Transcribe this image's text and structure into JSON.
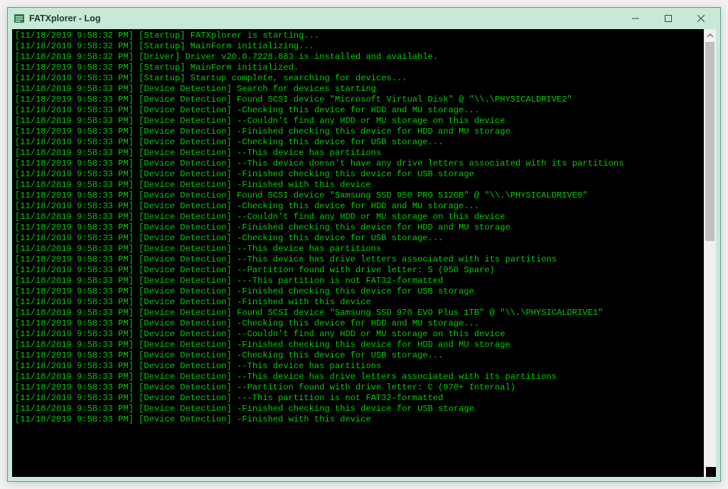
{
  "window": {
    "title": "FATXplorer - Log"
  },
  "log": {
    "lines": [
      {
        "ts": "[11/18/2019 9:58:32 PM]",
        "tag": "[Startup]",
        "msg": "FATXplorer is starting..."
      },
      {
        "ts": "[11/18/2019 9:58:32 PM]",
        "tag": "[Startup]",
        "msg": "MainForm initializing..."
      },
      {
        "ts": "[11/18/2019 9:58:32 PM]",
        "tag": "[Driver]",
        "msg": "Driver v20.0.7228.883 is installed and available."
      },
      {
        "ts": "[11/18/2019 9:58:32 PM]",
        "tag": "[Startup]",
        "msg": "MainForm initialized."
      },
      {
        "ts": "[11/18/2019 9:58:33 PM]",
        "tag": "[Startup]",
        "msg": "Startup complete, searching for devices..."
      },
      {
        "ts": "[11/18/2019 9:58:33 PM]",
        "tag": "[Device Detection]",
        "msg": "Search for devices starting"
      },
      {
        "ts": "[11/18/2019 9:58:33 PM]",
        "tag": "[Device Detection]",
        "msg": "Found SCSI device \"Microsoft Virtual Disk\" @ \"\\\\.\\PHYSICALDRIVE2\""
      },
      {
        "ts": "[11/18/2019 9:58:33 PM]",
        "tag": "[Device Detection]",
        "msg": "-Checking this device for HDD and MU storage..."
      },
      {
        "ts": "[11/18/2019 9:58:33 PM]",
        "tag": "[Device Detection]",
        "msg": "--Couldn't find any HDD or MU storage on this device"
      },
      {
        "ts": "[11/18/2019 9:58:33 PM]",
        "tag": "[Device Detection]",
        "msg": "-Finished checking this device for HDD and MU storage"
      },
      {
        "ts": "[11/18/2019 9:58:33 PM]",
        "tag": "[Device Detection]",
        "msg": "-Checking this device for USB storage..."
      },
      {
        "ts": "[11/18/2019 9:58:33 PM]",
        "tag": "[Device Detection]",
        "msg": "--This device has partitions"
      },
      {
        "ts": "[11/18/2019 9:58:33 PM]",
        "tag": "[Device Detection]",
        "msg": "--This device doesn't have any drive letters associated with its partitions"
      },
      {
        "ts": "[11/18/2019 9:58:33 PM]",
        "tag": "[Device Detection]",
        "msg": "-Finished checking this device for USB storage"
      },
      {
        "ts": "[11/18/2019 9:58:33 PM]",
        "tag": "[Device Detection]",
        "msg": "-Finished with this device"
      },
      {
        "ts": "[11/18/2019 9:58:33 PM]",
        "tag": "[Device Detection]",
        "msg": "Found SCSI device \"Samsung SSD 950 PRO 512GB\" @ \"\\\\.\\PHYSICALDRIVE0\""
      },
      {
        "ts": "[11/18/2019 9:58:33 PM]",
        "tag": "[Device Detection]",
        "msg": "-Checking this device for HDD and MU storage..."
      },
      {
        "ts": "[11/18/2019 9:58:33 PM]",
        "tag": "[Device Detection]",
        "msg": "--Couldn't find any HDD or MU storage on this device"
      },
      {
        "ts": "[11/18/2019 9:58:33 PM]",
        "tag": "[Device Detection]",
        "msg": "-Finished checking this device for HDD and MU storage"
      },
      {
        "ts": "[11/18/2019 9:58:33 PM]",
        "tag": "[Device Detection]",
        "msg": "-Checking this device for USB storage..."
      },
      {
        "ts": "[11/18/2019 9:58:33 PM]",
        "tag": "[Device Detection]",
        "msg": "--This device has partitions"
      },
      {
        "ts": "[11/18/2019 9:58:33 PM]",
        "tag": "[Device Detection]",
        "msg": "--This device has drive letters associated with its partitions"
      },
      {
        "ts": "[11/18/2019 9:58:33 PM]",
        "tag": "[Device Detection]",
        "msg": "--Partition found with drive letter: S (950 Spare)"
      },
      {
        "ts": "[11/18/2019 9:58:33 PM]",
        "tag": "[Device Detection]",
        "msg": "---This partition is not FAT32-formatted"
      },
      {
        "ts": "[11/18/2019 9:58:33 PM]",
        "tag": "[Device Detection]",
        "msg": "-Finished checking this device for USB storage"
      },
      {
        "ts": "[11/18/2019 9:58:33 PM]",
        "tag": "[Device Detection]",
        "msg": "-Finished with this device"
      },
      {
        "ts": "[11/18/2019 9:58:33 PM]",
        "tag": "[Device Detection]",
        "msg": "Found SCSI device \"Samsung SSD 970 EVO Plus 1TB\" @ \"\\\\.\\PHYSICALDRIVE1\""
      },
      {
        "ts": "[11/18/2019 9:58:33 PM]",
        "tag": "[Device Detection]",
        "msg": "-Checking this device for HDD and MU storage..."
      },
      {
        "ts": "[11/18/2019 9:58:33 PM]",
        "tag": "[Device Detection]",
        "msg": "--Couldn't find any HDD or MU storage on this device"
      },
      {
        "ts": "[11/18/2019 9:58:33 PM]",
        "tag": "[Device Detection]",
        "msg": "-Finished checking this device for HDD and MU storage"
      },
      {
        "ts": "[11/18/2019 9:58:33 PM]",
        "tag": "[Device Detection]",
        "msg": "-Checking this device for USB storage..."
      },
      {
        "ts": "[11/18/2019 9:58:33 PM]",
        "tag": "[Device Detection]",
        "msg": "--This device has partitions"
      },
      {
        "ts": "[11/18/2019 9:58:33 PM]",
        "tag": "[Device Detection]",
        "msg": "--This device has drive letters associated with its partitions"
      },
      {
        "ts": "[11/18/2019 9:58:33 PM]",
        "tag": "[Device Detection]",
        "msg": "--Partition found with drive letter: C (970+ Internal)"
      },
      {
        "ts": "[11/18/2019 9:58:33 PM]",
        "tag": "[Device Detection]",
        "msg": "---This partition is not FAT32-formatted"
      },
      {
        "ts": "[11/18/2019 9:58:33 PM]",
        "tag": "[Device Detection]",
        "msg": "-Finished checking this device for USB storage"
      },
      {
        "ts": "[11/18/2019 9:58:33 PM]",
        "tag": "[Device Detection]",
        "msg": "-Finished with this device"
      }
    ]
  }
}
